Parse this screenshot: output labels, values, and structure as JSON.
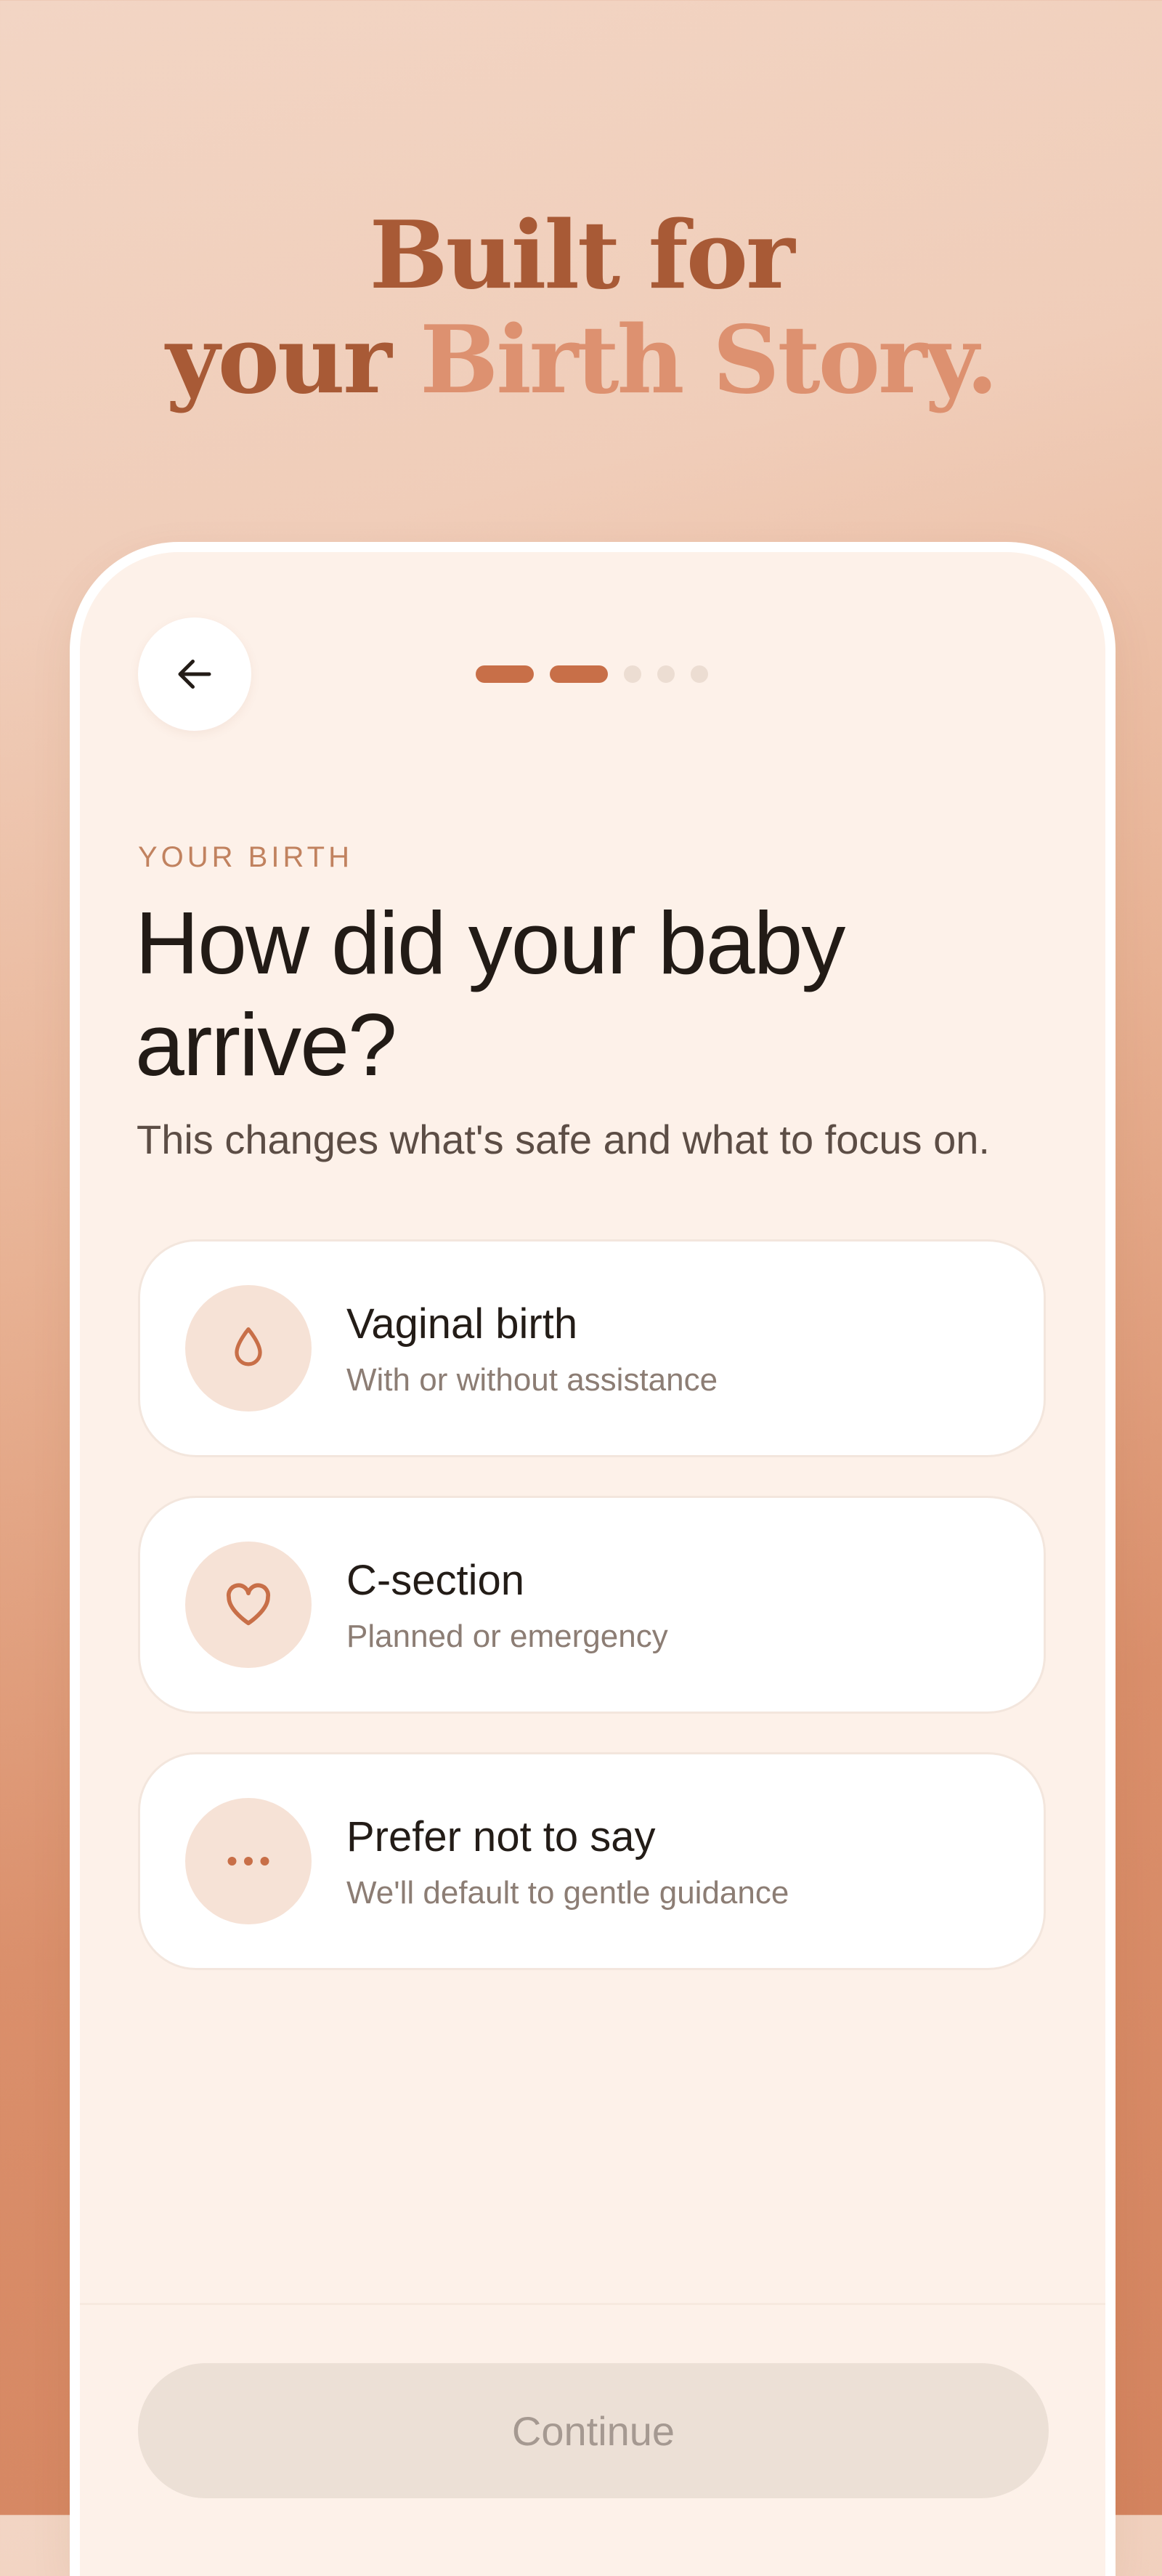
{
  "headline": {
    "line1": "Built for",
    "line2_prefix": "your ",
    "line2_accent": "Birth Story."
  },
  "progress": {
    "current_step": 2,
    "total_steps": 5
  },
  "screen": {
    "eyebrow": "YOUR BIRTH",
    "title": "How did your baby arrive?",
    "subtitle": "This changes what's safe and what to focus on."
  },
  "options": [
    {
      "label": "Vaginal birth",
      "description": "With or without assistance",
      "icon": "droplet-icon"
    },
    {
      "label": "C-section",
      "description": "Planned or emergency",
      "icon": "heart-icon"
    },
    {
      "label": "Prefer not to say",
      "description": "We'll default to gentle guidance",
      "icon": "more-dots-icon"
    }
  ],
  "continue_label": "Continue",
  "colors": {
    "accent": "#c86f48",
    "headline": "#a85a36",
    "headline_accent": "#dd9170",
    "card_bg": "#fdf1e9"
  }
}
